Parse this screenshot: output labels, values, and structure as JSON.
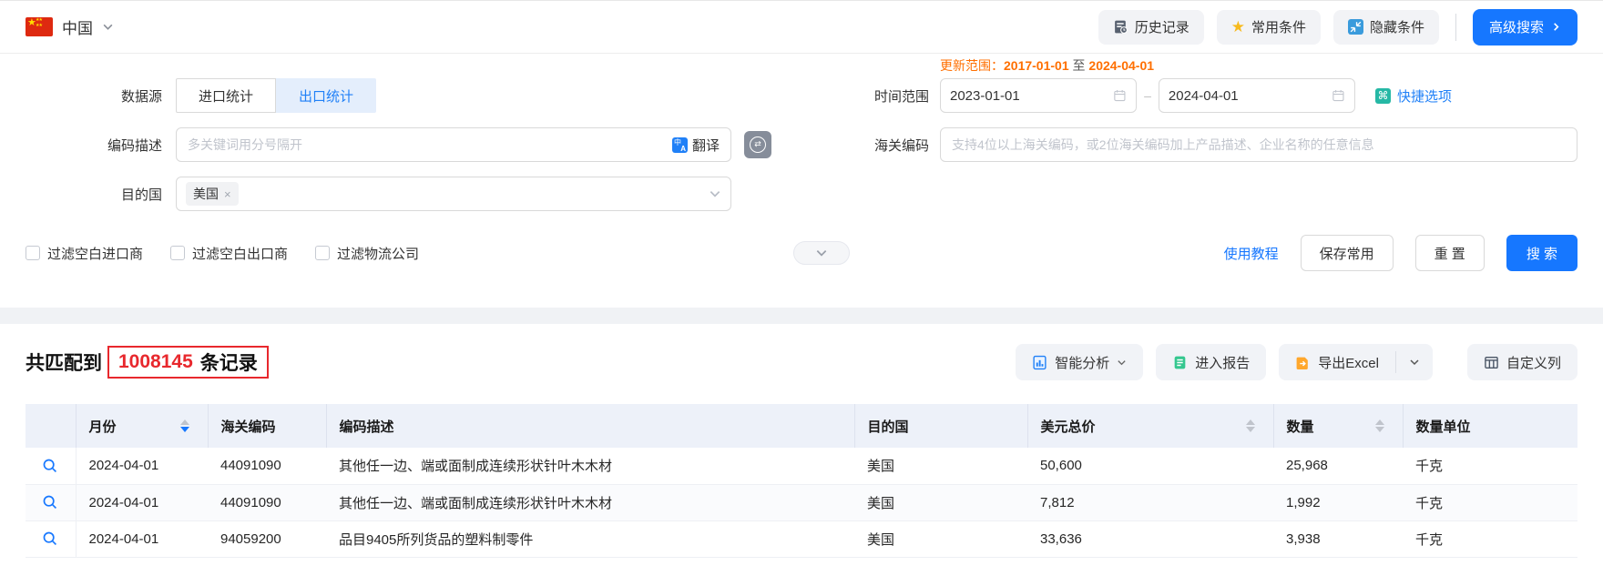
{
  "topbar": {
    "country": "中国",
    "history_label": "历史记录",
    "favorites_label": "常用条件",
    "hide_label": "隐藏条件",
    "advanced_label": "高级搜索"
  },
  "form": {
    "data_source": {
      "label": "数据源",
      "tabs": [
        {
          "label": "进口统计",
          "active": false
        },
        {
          "label": "出口统计",
          "active": true
        }
      ]
    },
    "update_range": {
      "label": "更新范围：",
      "from": "2017-01-01",
      "sep": "至",
      "to": "2024-04-01"
    },
    "time_range": {
      "label": "时间范围",
      "from": "2023-01-01",
      "to": "2024-04-01",
      "quick_label": "快捷选项"
    },
    "code_desc": {
      "label": "编码描述",
      "placeholder": "多关键词用分号隔开",
      "translate_label": "翻译"
    },
    "hs_code": {
      "label": "海关编码",
      "placeholder": "支持4位以上海关编码，或2位海关编码加上产品描述、企业名称的任意信息"
    },
    "destination": {
      "label": "目的国",
      "tag": "美国",
      "tag_close": "×"
    },
    "filters": [
      "过滤空白进口商",
      "过滤空白出口商",
      "过滤物流公司"
    ],
    "actions": {
      "tutorial": "使用教程",
      "save": "保存常用",
      "reset": "重 置",
      "search": "搜 索"
    }
  },
  "results": {
    "prefix": "共匹配到",
    "count": "1008145",
    "suffix": "条记录",
    "analyze_label": "智能分析",
    "report_label": "进入报告",
    "export_label": "导出Excel",
    "columns_label": "自定义列"
  },
  "table": {
    "columns": [
      {
        "label": "月份",
        "sortable": true,
        "sort": "desc"
      },
      {
        "label": "海关编码",
        "sortable": false
      },
      {
        "label": "编码描述",
        "sortable": false
      },
      {
        "label": "目的国",
        "sortable": false
      },
      {
        "label": "美元总价",
        "sortable": true,
        "sort": "none"
      },
      {
        "label": "数量",
        "sortable": true,
        "sort": "none"
      },
      {
        "label": "数量单位",
        "sortable": false
      }
    ],
    "rows": [
      {
        "cells": [
          "2024-04-01",
          "44091090",
          "其他任一边、端或面制成连续形状针叶木木材",
          "美国",
          "50,600",
          "25,968",
          "千克"
        ]
      },
      {
        "cells": [
          "2024-04-01",
          "44091090",
          "其他任一边、端或面制成连续形状针叶木木材",
          "美国",
          "7,812",
          "1,992",
          "千克"
        ]
      },
      {
        "cells": [
          "2024-04-01",
          "94059200",
          "品目9405所列货品的塑料制零件",
          "美国",
          "33,636",
          "3,938",
          "千克"
        ]
      }
    ]
  },
  "colors": {
    "primary_blue": "#1677ff",
    "link_blue": "#2080f7",
    "active_tab_bg": "#e4eefc",
    "orange": "#ff6f00",
    "alert_red": "#e8282d",
    "header_bg": "#edf1f9",
    "band_gray": "#f0f2f5",
    "button_gray": "#f1f3f7",
    "flag_red": "#de2910",
    "star_yellow": "#ffde00",
    "report_green": "#34c78f",
    "excel_orange": "#ffa72c",
    "quick_teal": "#26b8a5"
  }
}
